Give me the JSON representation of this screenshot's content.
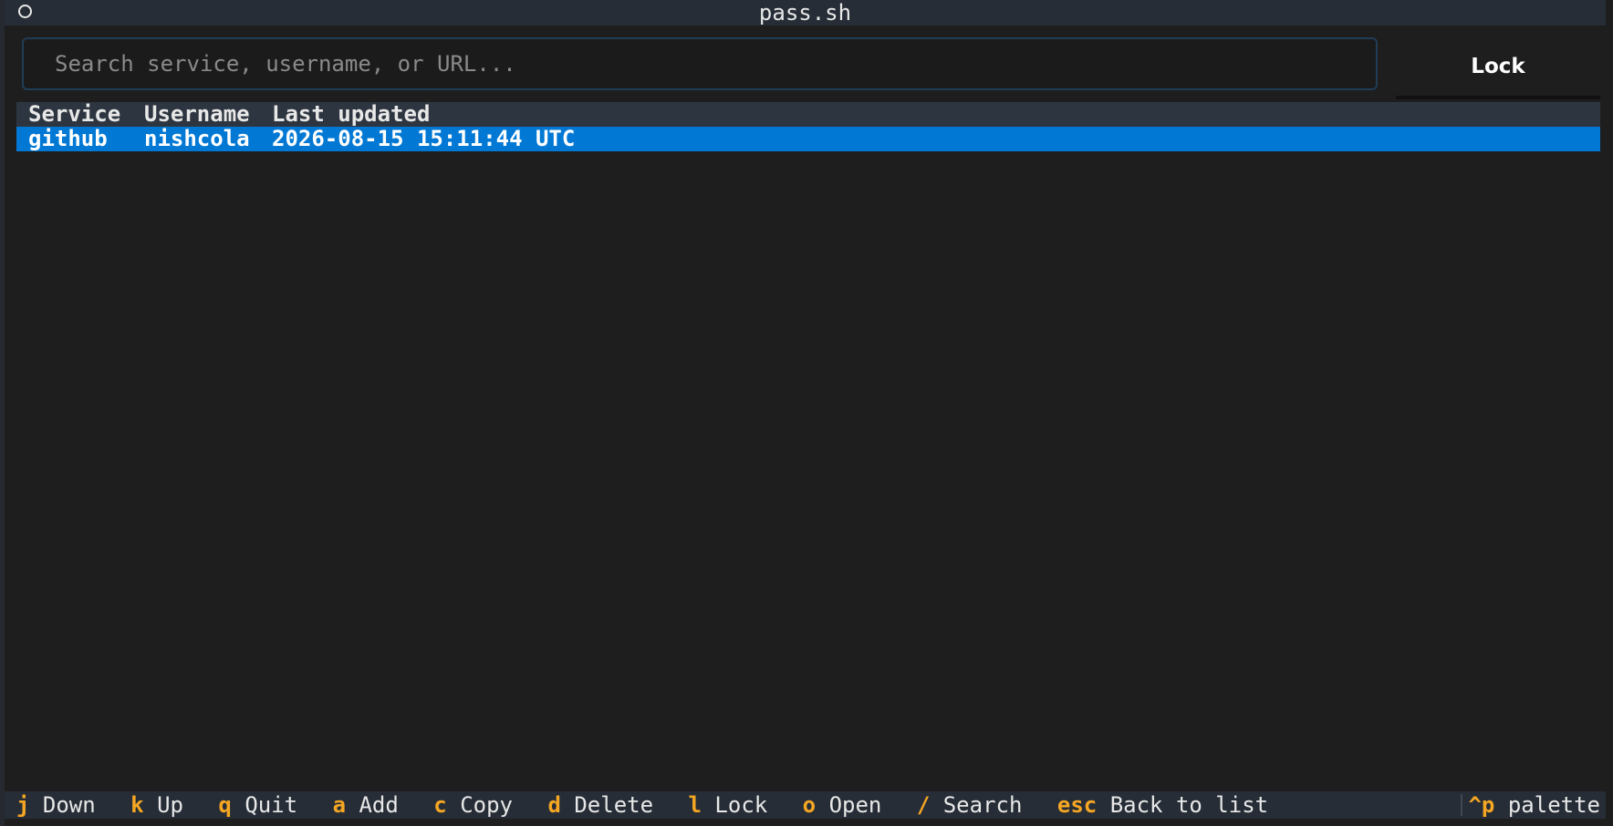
{
  "window": {
    "title": "pass.sh",
    "icon": "circle-icon"
  },
  "search": {
    "placeholder": "Search service, username, or URL...",
    "value": ""
  },
  "toolbar": {
    "lock_label": "Lock"
  },
  "table": {
    "columns": [
      "Service",
      "Username",
      "Last updated"
    ],
    "rows": [
      {
        "service": "github",
        "username": "nishcola",
        "last_updated": "2026-08-15 15:11:44 UTC",
        "selected": true
      }
    ]
  },
  "footer": {
    "shortcuts": [
      {
        "key": "j",
        "label": "Down"
      },
      {
        "key": "k",
        "label": "Up"
      },
      {
        "key": "q",
        "label": "Quit"
      },
      {
        "key": "a",
        "label": "Add"
      },
      {
        "key": "c",
        "label": "Copy"
      },
      {
        "key": "d",
        "label": "Delete"
      },
      {
        "key": "l",
        "label": "Lock"
      },
      {
        "key": "o",
        "label": "Open"
      },
      {
        "key": "/",
        "label": "Search"
      },
      {
        "key": "esc",
        "label": "Back to list"
      }
    ],
    "palette": {
      "key": "^p",
      "label": "palette"
    }
  },
  "colors": {
    "background": "#1e1e1e",
    "titlebar": "#262d36",
    "selection": "#0078d4",
    "key_accent": "#f5a623",
    "search_border": "#1f3d57"
  }
}
